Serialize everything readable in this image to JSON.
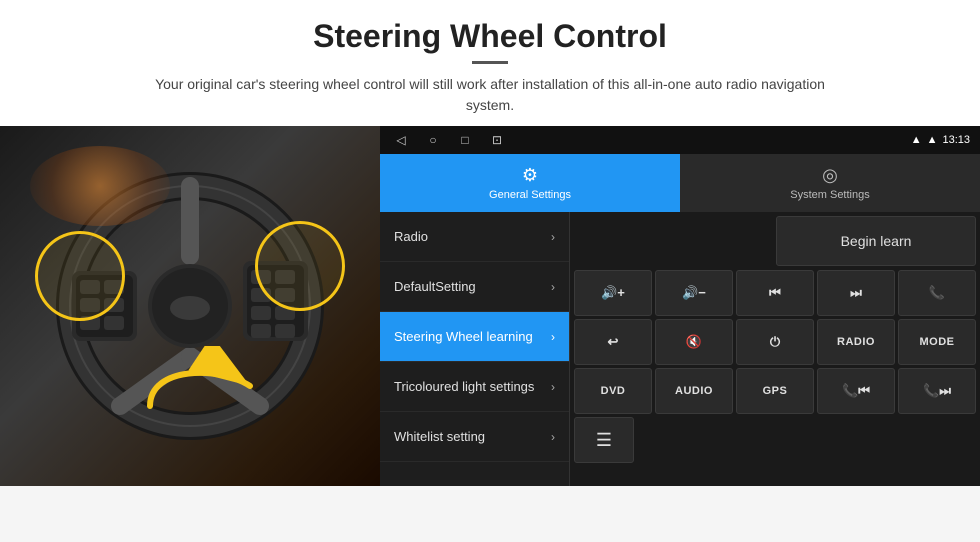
{
  "header": {
    "title": "Steering Wheel Control",
    "subtitle": "Your original car's steering wheel control will still work after installation of this all-in-one auto radio navigation system."
  },
  "statusBar": {
    "time": "13:13",
    "navButtons": [
      "◁",
      "○",
      "□",
      "⊡"
    ]
  },
  "tabs": [
    {
      "id": "general",
      "label": "General Settings",
      "icon": "⚙",
      "active": true
    },
    {
      "id": "system",
      "label": "System Settings",
      "icon": "◎",
      "active": false
    }
  ],
  "menu": {
    "items": [
      {
        "id": "radio",
        "label": "Radio",
        "active": false
      },
      {
        "id": "default",
        "label": "DefaultSetting",
        "active": false
      },
      {
        "id": "steering",
        "label": "Steering Wheel learning",
        "active": true
      },
      {
        "id": "tricoloured",
        "label": "Tricoloured light settings",
        "active": false
      },
      {
        "id": "whitelist",
        "label": "Whitelist setting",
        "active": false
      }
    ]
  },
  "controls": {
    "beginLearn": "Begin learn",
    "buttons": [
      [
        "🔊+",
        "🔊-",
        "⏮",
        "⏭",
        "📞"
      ],
      [
        "↩",
        "🔊✕",
        "⏻",
        "RADIO",
        "MODE"
      ],
      [
        "DVD",
        "AUDIO",
        "GPS",
        "📞⏮",
        "📞⏭"
      ]
    ],
    "bottomIcon": "≡"
  }
}
